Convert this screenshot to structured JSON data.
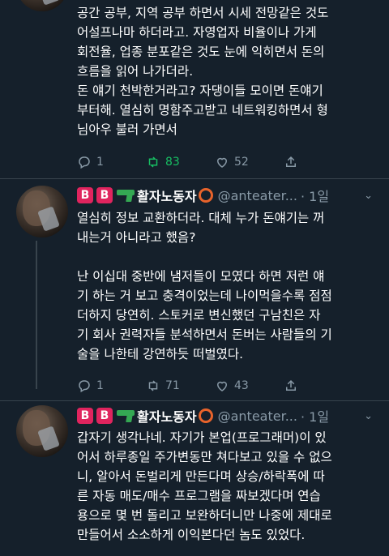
{
  "tweet1": {
    "text": "공간 공부, 지역 공부 하면서 시세 전망같은 것도\n어설프나마 하더라고. 자영업자 비율이나 가게\n회전율, 업종 분포같은 것도 눈에 익히면서 돈의\n흐름을 읽어 나가더라.\n돈 얘기 천박한거라고? 자댕이들 모이면 돈얘기\n부터해. 열심히 명함주고받고 네트워킹하면서 형\n님아우 불러 가면서",
    "reply_count": "1",
    "retweet_count": "83",
    "like_count": "52"
  },
  "tweet2": {
    "badge1": "B",
    "badge2": "B",
    "display_name": "활자노동자",
    "handle": "@anteater...",
    "time": "· 1일",
    "text": "열심히 정보 교환하더라. 대체 누가 돈얘기는 꺼\n내는거 아니라고 했음?\n\n난 이십대 중반에 냄저들이 모였다 하면 저런 얘\n기 하는 거 보고 충격이었는데 나이먹을수록 점점\n더하지 당연히. 스토커로 변신했던 구남친은 자\n기 회사 권력자들 분석하면서 돈버는 사람들의 기\n술을 나한테 강연하듯 떠벌였다.",
    "reply_count": "1",
    "retweet_count": "71",
    "like_count": "43"
  },
  "tweet3": {
    "badge1": "B",
    "badge2": "B",
    "display_name": "활자노동자",
    "handle": "@anteater...",
    "time": "· 1일",
    "text": "갑자기 생각나네. 자기가 본업(프로그래머)이 있\n어서 하루종일 주가변동만 쳐다보고 있을 수 없으\n니, 알아서 돈벌리게 만든다며 상승/하락폭에 따\n른 자동 매도/매수 프로그램을 짜보겠다며 연습\n용으로 몇 번 돌리고 보완하더니만 나중에 제대로\n만들어서 소소하게 이익본다던 놈도 있었다."
  },
  "colors": {
    "background": "#15202b",
    "muted": "#8899a6",
    "retweet_active": "#17bf63",
    "badge": "#e0245e"
  },
  "icons": [
    "reply-icon",
    "retweet-icon",
    "like-icon",
    "share-icon",
    "chevron-down-icon"
  ]
}
